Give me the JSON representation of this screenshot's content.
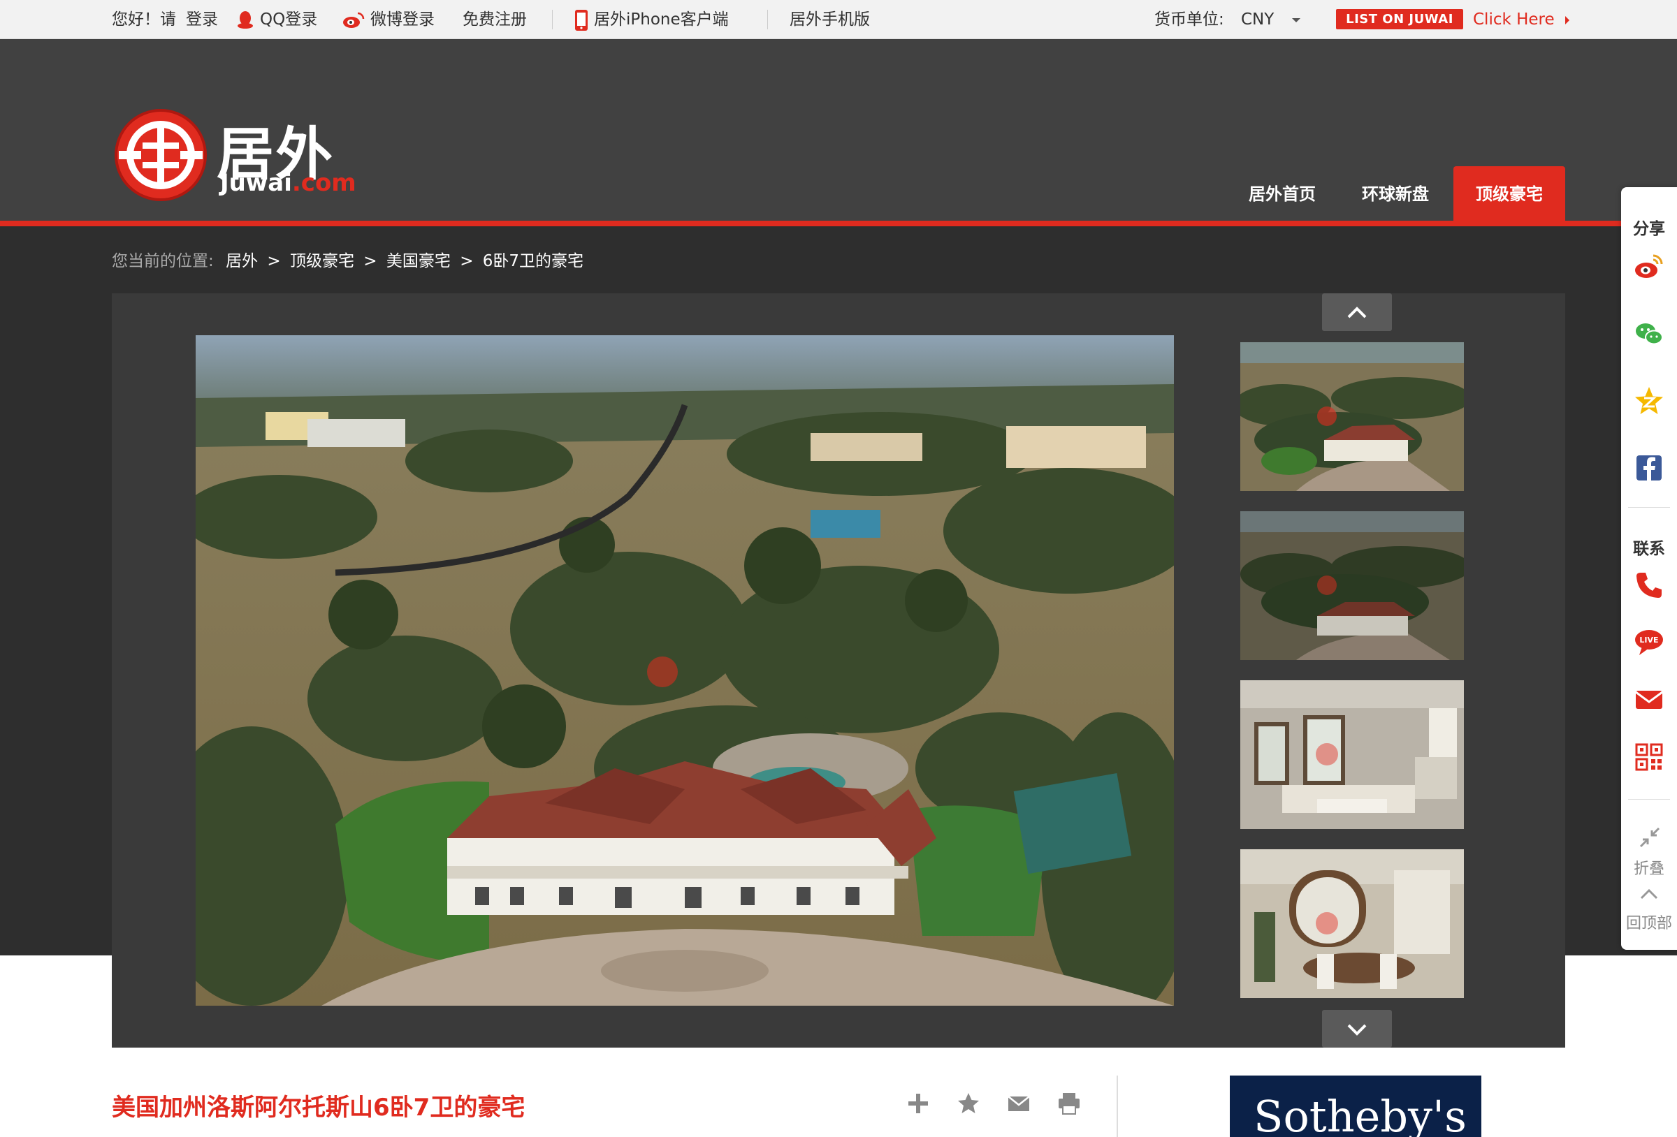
{
  "topbar": {
    "greeting": "您好！请",
    "login": "登录",
    "qq_login": "QQ登录",
    "weibo_login": "微博登录",
    "register": "免费注册",
    "iphone_client": "居外iPhone客户端",
    "mobile_site": "居外手机版",
    "currency_label": "货币单位:",
    "currency_value": "CNY",
    "list_btn": "LIST ON JUWAI",
    "click_here": "Click Here"
  },
  "logo": {
    "cn": "居外",
    "en_main": "Juwai",
    "en_suffix": ".com"
  },
  "nav": {
    "items": [
      {
        "label": "居外首页"
      },
      {
        "label": "环球新盘"
      },
      {
        "label": "顶级豪宅"
      }
    ]
  },
  "breadcrumb": {
    "prefix": "您当前的位置:",
    "items": [
      "居外",
      "顶级豪宅",
      "美国豪宅",
      "6卧7卫的豪宅"
    ],
    "separator": ">"
  },
  "property": {
    "title": "美国加州洛斯阿尔托斯山6卧7卫的豪宅"
  },
  "ad": {
    "text": "Sotheby's"
  },
  "sharebar": {
    "share_label": "分享",
    "contact_label": "联系",
    "collapse_label": "折叠",
    "top_label": "回顶部",
    "live_text": "LIVE"
  },
  "colors": {
    "brand_red": "#e02b1f",
    "header_bg": "#414141",
    "band_bg": "#2e2e2e",
    "gallery_bg": "#3a3a3a"
  }
}
